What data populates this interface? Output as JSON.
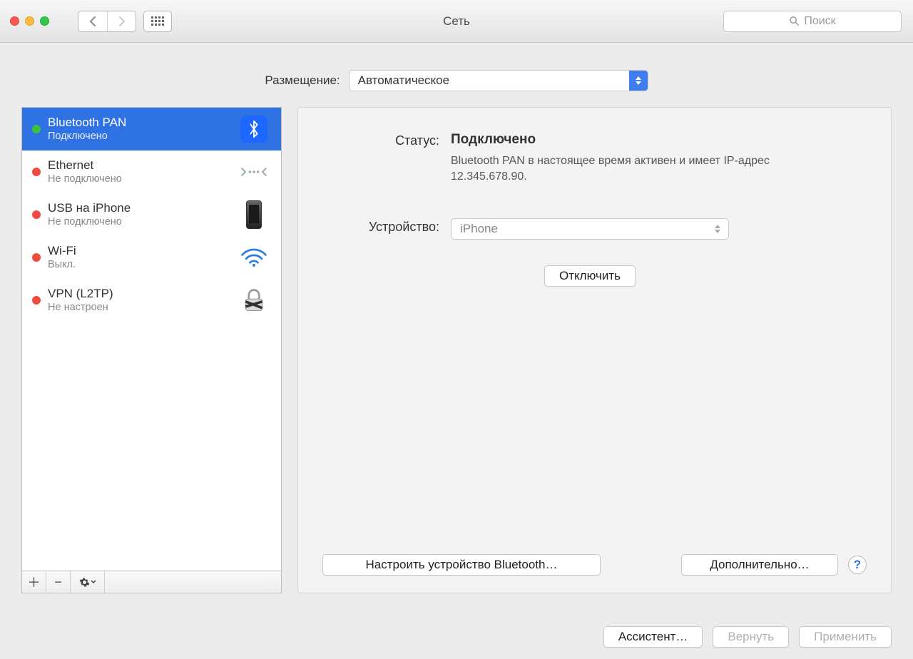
{
  "window": {
    "title": "Сеть"
  },
  "search": {
    "placeholder": "Поиск"
  },
  "location": {
    "label": "Размещение:",
    "value": "Автоматическое"
  },
  "sidebar": {
    "items": [
      {
        "name": "Bluetooth PAN",
        "sub": "Подключено",
        "status": "green",
        "icon": "bluetooth-icon",
        "selected": true
      },
      {
        "name": "Ethernet",
        "sub": "Не подключено",
        "status": "red",
        "icon": "ethernet-icon"
      },
      {
        "name": "USB на iPhone",
        "sub": "Не подключено",
        "status": "red",
        "icon": "phone-icon"
      },
      {
        "name": "Wi-Fi",
        "sub": "Выкл.",
        "status": "red",
        "icon": "wifi-icon"
      },
      {
        "name": "VPN (L2TP)",
        "sub": "Не настроен",
        "status": "red",
        "icon": "lock-icon"
      }
    ]
  },
  "detail": {
    "status_label": "Статус:",
    "status_value": "Подключено",
    "status_desc": "Bluetooth PAN в настоящее время активен и имеет IP-адрес 12.345.678.90.",
    "device_label": "Устройство:",
    "device_value": "iPhone",
    "disconnect_label": "Отключить",
    "configure_bt_label": "Настроить устройство Bluetooth…",
    "advanced_label": "Дополнительно…"
  },
  "footer": {
    "assistant_label": "Ассистент…",
    "revert_label": "Вернуть",
    "apply_label": "Применить"
  }
}
